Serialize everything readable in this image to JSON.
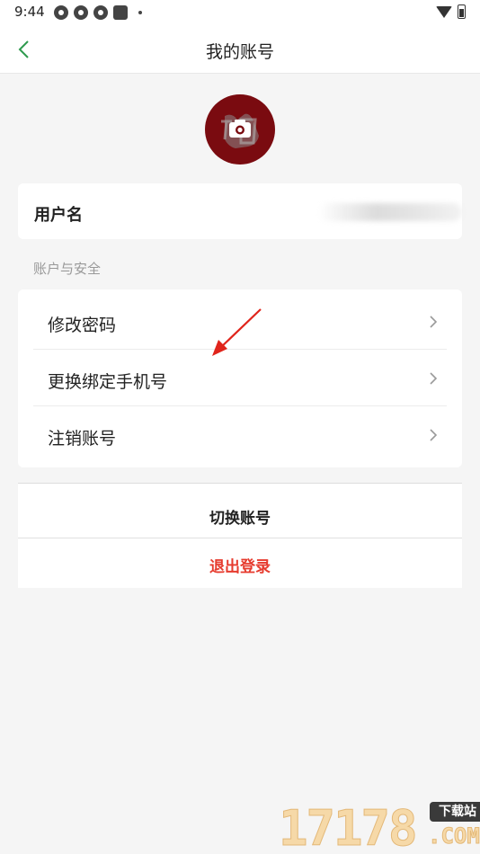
{
  "status_bar": {
    "time": "9:44"
  },
  "nav": {
    "title": "我的账号",
    "back_icon": "chevron-left-icon",
    "accent_color": "#2e9a4e"
  },
  "profile": {
    "avatar_icon": "camera-icon",
    "avatar_color": "#7a0b10"
  },
  "username": {
    "label": "用户名"
  },
  "security_section": {
    "label": "账户与安全",
    "items": [
      {
        "label": "修改密码",
        "icon": "chevron-right-icon"
      },
      {
        "label": "更换绑定手机号",
        "icon": "chevron-right-icon"
      },
      {
        "label": "注销账号",
        "icon": "chevron-right-icon"
      }
    ]
  },
  "actions": {
    "switch_account": "切换账号",
    "logout": "退出登录",
    "logout_color": "#e63b2e"
  },
  "watermark": {
    "digits": "17178",
    "badge": "下载站",
    "domain": ".COM"
  }
}
